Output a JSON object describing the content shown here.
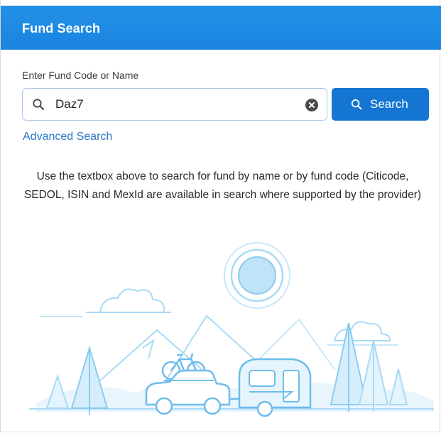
{
  "header": {
    "title": "Fund Search"
  },
  "search": {
    "label": "Enter Fund Code or Name",
    "value": "Daz7",
    "button_label": "Search",
    "advanced_link": "Advanced Search"
  },
  "help": {
    "text": "Use the textbox above to search for fund by name or by fund code (Citicode, SEDOL, ISIN and MexId are available in search where supported by the provider)"
  },
  "icons": {
    "search": "search-icon",
    "clear": "clear-icon",
    "illustration": "camping-scene-illustration"
  },
  "colors": {
    "header": "#1e88e5",
    "button": "#1476d2",
    "link": "#2a79c7",
    "illustration": "#9fd3f3"
  }
}
